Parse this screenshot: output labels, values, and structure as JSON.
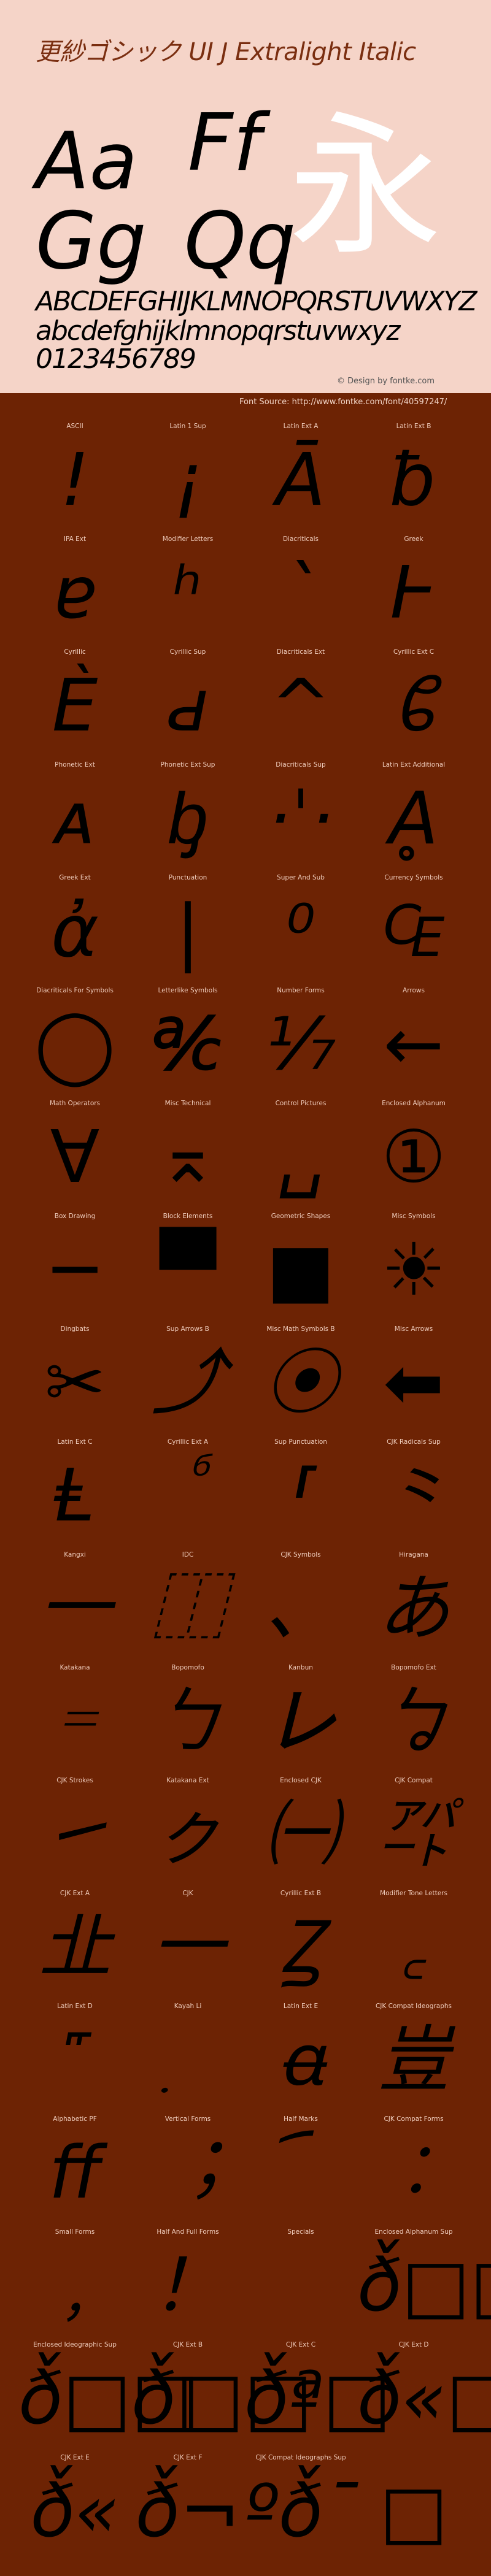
{
  "header": {
    "title": "更紗ゴシック UI J Extralight Italic",
    "sample_pairs": [
      "Aa",
      "Ff",
      "Gg",
      "Qq"
    ],
    "kanji": "永",
    "uppercase": "ABCDEFGHIJKLMNOPQRSTUVWXYZ",
    "lowercase": "abcdefghijklmnopqrstuvwxyz",
    "digits": "0123456789",
    "credit": "© Design by fontke.com",
    "source": "Font Source: http://www.fontke.com/font/40597247/"
  },
  "colors": {
    "header_bg": "#f5d4c8",
    "title": "#7a2e10",
    "body_bg": "#6d2304",
    "label": "#f0cdbd",
    "glyph": "#000000",
    "kanji": "#ffffff"
  },
  "blocks": [
    {
      "label": "ASCII",
      "glyph": "!"
    },
    {
      "label": "Latin 1 Sup",
      "glyph": "¡"
    },
    {
      "label": "Latin Ext A",
      "glyph": "Ā"
    },
    {
      "label": "Latin Ext B",
      "glyph": "ƀ"
    },
    {
      "label": "IPA Ext",
      "glyph": "ɐ"
    },
    {
      "label": "Modifier Letters",
      "glyph": "ʰ"
    },
    {
      "label": "Diacriticals",
      "glyph": "`"
    },
    {
      "label": "Greek",
      "glyph": "Ͱ"
    },
    {
      "label": "Cyrillic",
      "glyph": "Ѐ"
    },
    {
      "label": "Cyrillic Sup",
      "glyph": "ԁ"
    },
    {
      "label": "Diacriticals Ext",
      "glyph": "^"
    },
    {
      "label": "Cyrillic Ext C",
      "glyph": "ᲀ"
    },
    {
      "label": "Phonetic Ext",
      "glyph": "ᴀ"
    },
    {
      "label": "Phonetic Ext Sup",
      "glyph": "ᶀ"
    },
    {
      "label": "Diacriticals Sup",
      "glyph": "·ˈ·"
    },
    {
      "label": "Latin Ext Additional",
      "glyph": "Ḁ"
    },
    {
      "label": "Greek Ext",
      "glyph": "ἀ"
    },
    {
      "label": "Punctuation",
      "glyph": "|"
    },
    {
      "label": "Super And Sub",
      "glyph": "⁰"
    },
    {
      "label": "Currency Symbols",
      "glyph": "₠"
    },
    {
      "label": "Diacriticals For Symbols",
      "glyph": "◯"
    },
    {
      "label": "Letterlike Symbols",
      "glyph": "℀"
    },
    {
      "label": "Number Forms",
      "glyph": "⅐"
    },
    {
      "label": "Arrows",
      "glyph": "←"
    },
    {
      "label": "Math Operators",
      "glyph": "∀"
    },
    {
      "label": "Misc Technical",
      "glyph": "⌅"
    },
    {
      "label": "Control Pictures",
      "glyph": "␣"
    },
    {
      "label": "Enclosed Alphanum",
      "glyph": "①"
    },
    {
      "label": "Box Drawing",
      "glyph": "─"
    },
    {
      "label": "Block Elements",
      "glyph": "▀"
    },
    {
      "label": "Geometric Shapes",
      "glyph": "■"
    },
    {
      "label": "Misc Symbols",
      "glyph": "☀"
    },
    {
      "label": "Dingbats",
      "glyph": "✂"
    },
    {
      "label": "Sup Arrows B",
      "glyph": "⤴"
    },
    {
      "label": "Misc Math Symbols B",
      "glyph": "⦿"
    },
    {
      "label": "Misc Arrows",
      "glyph": "⬅"
    },
    {
      "label": "Latin Ext C",
      "glyph": "Ⱡ"
    },
    {
      "label": "Cyrillic Ext A",
      "glyph": "ⷠ"
    },
    {
      "label": "Sup Punctuation",
      "glyph": "⸢"
    },
    {
      "label": "CJK Radicals Sup",
      "glyph": "⺀"
    },
    {
      "label": "Kangxi",
      "glyph": "⼀"
    },
    {
      "label": "IDC",
      "glyph": "⿰"
    },
    {
      "label": "CJK Symbols",
      "glyph": "、"
    },
    {
      "label": "Hiragana",
      "glyph": "あ"
    },
    {
      "label": "Katakana",
      "glyph": "゠"
    },
    {
      "label": "Bopomofo",
      "glyph": "ㄅ"
    },
    {
      "label": "Kanbun",
      "glyph": "㆑"
    },
    {
      "label": "Bopomofo Ext",
      "glyph": "ㆠ"
    },
    {
      "label": "CJK Strokes",
      "glyph": "㇀"
    },
    {
      "label": "Katakana Ext",
      "glyph": "ㇰ"
    },
    {
      "label": "Enclosed CJK",
      "glyph": "㈠"
    },
    {
      "label": "CJK Compat",
      "glyph": "㌀"
    },
    {
      "label": "CJK Ext A",
      "glyph": "㐀"
    },
    {
      "label": "CJK",
      "glyph": "一"
    },
    {
      "label": "Cyrillic Ext B",
      "glyph": "Ꙁ"
    },
    {
      "label": "Modifier Tone Letters",
      "glyph": "꜀"
    },
    {
      "label": "Latin Ext D",
      "glyph": "꜠"
    },
    {
      "label": "Kayah Li",
      "glyph": "꤫"
    },
    {
      "label": "Latin Ext E",
      "glyph": "ꬰ"
    },
    {
      "label": "CJK Compat Ideographs",
      "glyph": "豈"
    },
    {
      "label": "Alphabetic PF",
      "glyph": "ﬀ"
    },
    {
      "label": "Vertical Forms",
      "glyph": "︔"
    },
    {
      "label": "Half Marks",
      "glyph": "︠"
    },
    {
      "label": "CJK Compat Forms",
      "glyph": "︰"
    },
    {
      "label": "Small Forms",
      "glyph": "﹐"
    },
    {
      "label": "Half And Full Forms",
      "glyph": "！"
    },
    {
      "label": "Specials",
      "glyph": "￼"
    },
    {
      "label": "Enclosed Alphanum Sup",
      "glyph": "ð̌□□"
    },
    {
      "label": "Enclosed Ideographic Sup",
      "glyph": "ð̌□□"
    },
    {
      "label": "CJK Ext B",
      "glyph": "ð̌□□"
    },
    {
      "label": "CJK Ext C",
      "glyph": "ð̌ª□"
    },
    {
      "label": "CJK Ext D",
      "glyph": "ð̌«□"
    },
    {
      "label": "CJK Ext E",
      "glyph": "ð̌«"
    },
    {
      "label": "CJK Ext F",
      "glyph": "ð̌¬"
    },
    {
      "label": "CJK Compat Ideographs Sup",
      "glyph": "ºð̌¯"
    },
    {
      "label": "",
      "glyph": "□"
    }
  ]
}
